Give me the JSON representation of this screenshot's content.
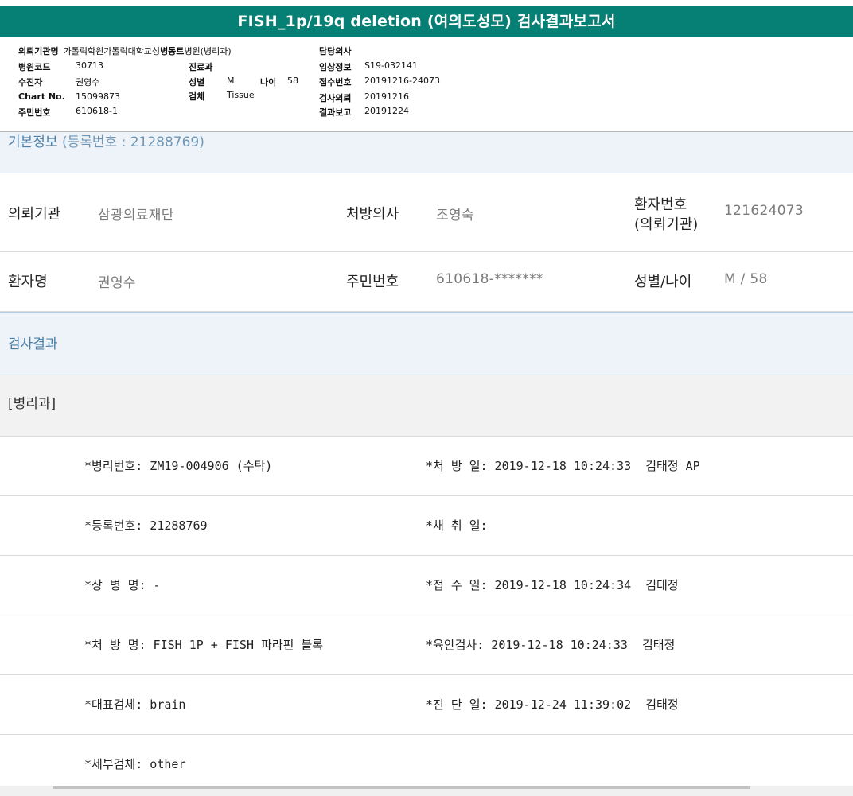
{
  "title": "FISH_1p/19q deletion (여의도성모) 검사결과보고서",
  "header": {
    "col1": [
      {
        "label": "의뢰기관명",
        "value": "가톨릭학원가톨릭대학교성"
      },
      {
        "label": "병원코드",
        "value": "30713"
      },
      {
        "label": "수진자",
        "value": "권영수"
      },
      {
        "label": "Chart No.",
        "value": "15099873"
      },
      {
        "label": "주민번호",
        "value": "610618-1"
      }
    ],
    "col2": {
      "dept": {
        "label": "병동트",
        "value": "병원(병리과)"
      },
      "clinic": {
        "label": "진료과",
        "value": ""
      },
      "sex": {
        "label": "성별",
        "value": "M"
      },
      "age": {
        "label": "나이",
        "value": "58"
      },
      "specimen": {
        "label": "검체",
        "value": "Tissue"
      }
    },
    "col3": [
      {
        "label": "담당의사",
        "value": ""
      },
      {
        "label": "임상정보",
        "value": "S19-032141"
      },
      {
        "label": "접수번호",
        "value": "20191216-24073"
      },
      {
        "label": "검사의뢰",
        "value": "20191216"
      },
      {
        "label": "결과보고",
        "value": "20191224"
      }
    ]
  },
  "basic_info": {
    "heading": "기본정보",
    "reg_text": "(등록번호 : 21288769)",
    "rows": [
      {
        "l1": "의뢰기관",
        "v1": "삼광의료재단",
        "l2": "처방의사",
        "v2": "조영숙",
        "l3a": "환자번호",
        "l3b": "(의뢰기관)",
        "v3": "121624073"
      },
      {
        "l1": "환자명",
        "v1": "권영수",
        "l2": "주민번호",
        "v2": "610618-*******",
        "l3a": "성별/나이",
        "l3b": "",
        "v3": "M / 58"
      }
    ]
  },
  "result": {
    "heading": "검사결과",
    "dept": "[병리과]",
    "rows": [
      {
        "left": "*병리번호: ZM19-004906 (수탁)",
        "right": "*처 방 일: 2019-12-18 10:24:33  김태정 AP"
      },
      {
        "left": "*등록번호: 21288769",
        "right": "*채 취 일:"
      },
      {
        "left": "*상 병 명: -",
        "right": "*접 수 일: 2019-12-18 10:24:34  김태정"
      },
      {
        "left": "*처 방 명: FISH 1P + FISH 파라핀 블록",
        "right": "*육안검사: 2019-12-18 10:24:33  김태정"
      },
      {
        "left": "*대표검체: brain",
        "right": "*진 단 일: 2019-12-24 11:39:02  김태정"
      },
      {
        "left": "*세부검체: other",
        "right": ""
      }
    ]
  },
  "colors": {
    "title_bar": "#067f74",
    "section_text": "#4a7fa8",
    "section_bg": "#edf3f8"
  }
}
